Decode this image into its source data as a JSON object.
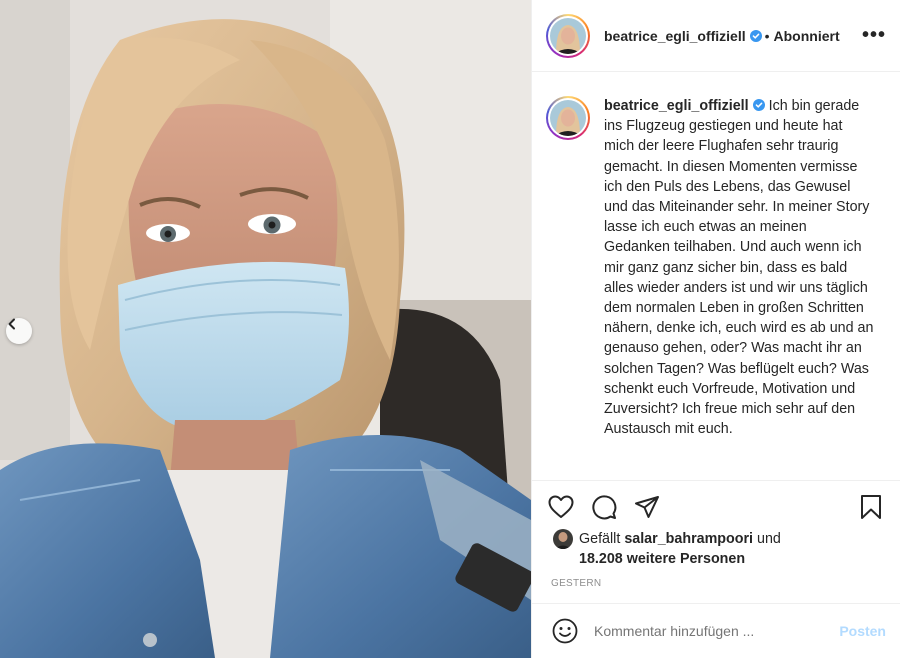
{
  "post": {
    "username": "beatrice_egli_offiziell",
    "follow_label": "Abonniert",
    "separator": "•",
    "more_label": "•••"
  },
  "caption": {
    "username": "beatrice_egli_offiziell",
    "text": "Ich bin gerade ins Flugzeug gestiegen und heute hat mich der leere Flughafen sehr traurig gemacht. In diesen Momenten vermisse ich den Puls des Lebens, das Gewusel und das Miteinander sehr. In meiner Story lasse ich euch etwas an meinen Gedanken teilhaben. Und auch wenn ich mir ganz ganz sicher bin, dass es bald alles wieder anders ist und wir uns täglich dem normalen Leben in großen Schritten nähern, denke ich, euch wird es ab und an genauso gehen, oder? Was macht ihr an solchen Tagen? Was beflügelt euch? Was schenkt euch Vorfreude, Motivation und Zuversicht? Ich freue mich sehr auf den Austausch mit euch."
  },
  "likes": {
    "prefix": "Gefällt",
    "liker": "salar_bahrampoori",
    "connector": "und",
    "count_text": "18.208 weitere Personen"
  },
  "date": "GESTERN",
  "comment": {
    "placeholder": "Kommentar hinzufügen ...",
    "post_label": "Posten"
  },
  "icons": {
    "carousel_prev": "chevron-left-icon",
    "verified": "verified-badge-icon",
    "like": "heart-icon",
    "comment": "comment-icon",
    "share": "paper-plane-icon",
    "save": "bookmark-icon",
    "emoji": "emoji-icon"
  },
  "colors": {
    "verified_blue": "#3897f0",
    "post_button_disabled": "#b3dbff",
    "secondary_text": "#8e8e8e"
  }
}
